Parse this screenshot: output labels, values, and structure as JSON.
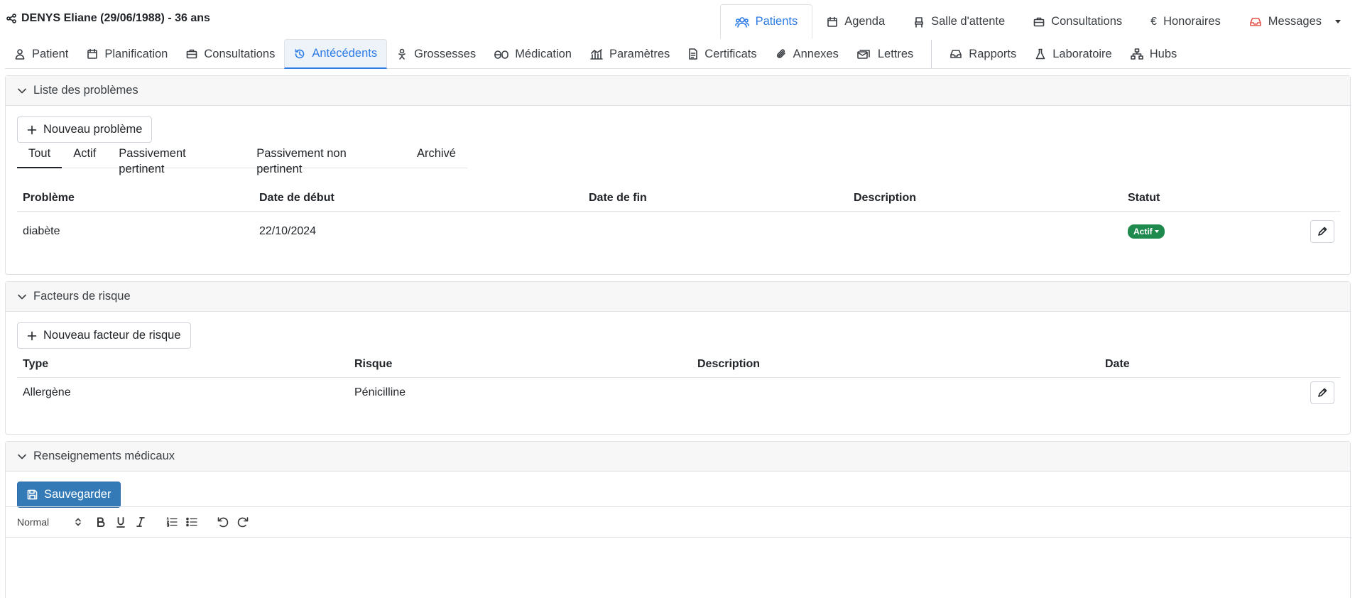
{
  "patient": {
    "title": "DENYS Eliane (29/06/1988) - 36 ans"
  },
  "topnav": [
    {
      "label": "Patients",
      "icon": "users-icon",
      "active": true
    },
    {
      "label": "Agenda",
      "icon": "calendar-icon"
    },
    {
      "label": "Salle d'attente",
      "icon": "chair-icon"
    },
    {
      "label": "Consultations",
      "icon": "briefcase-icon"
    },
    {
      "label": "Honoraires",
      "icon": "euro-icon"
    },
    {
      "label": "Messages",
      "icon": "inbox-icon"
    }
  ],
  "subnav": [
    {
      "label": "Patient"
    },
    {
      "label": "Planification"
    },
    {
      "label": "Consultations"
    },
    {
      "label": "Antécédents",
      "active": true
    },
    {
      "label": "Grossesses"
    },
    {
      "label": "Médication"
    },
    {
      "label": "Paramètres"
    },
    {
      "label": "Certificats"
    },
    {
      "label": "Annexes"
    },
    {
      "label": "Lettres"
    },
    {
      "label": "Rapports"
    },
    {
      "label": "Laboratoire"
    },
    {
      "label": "Hubs"
    }
  ],
  "problems": {
    "title": "Liste des problèmes",
    "new_button": "Nouveau problème",
    "filters": [
      "Tout",
      "Actif",
      "Passivement pertinent",
      "Passivement non pertinent",
      "Archivé"
    ],
    "columns": [
      "Problème",
      "Date de début",
      "Date de fin",
      "Description",
      "Statut"
    ],
    "rows": [
      {
        "probleme": "diabète",
        "debut": "22/10/2024",
        "fin": "",
        "description": "",
        "statut": "Actif"
      }
    ]
  },
  "risks": {
    "title": "Facteurs de risque",
    "new_button": "Nouveau facteur de risque",
    "columns": [
      "Type",
      "Risque",
      "Description",
      "Date"
    ],
    "rows": [
      {
        "type": "Allergène",
        "risque": "Pénicilline",
        "description": "",
        "date": ""
      }
    ]
  },
  "medical": {
    "title": "Renseignements médicaux",
    "save_button": "Sauvegarder",
    "format_select": "Normal"
  },
  "colors": {
    "accent": "#2c7be5",
    "primary_button": "#337ab7",
    "badge_active": "#1e8a4e"
  }
}
